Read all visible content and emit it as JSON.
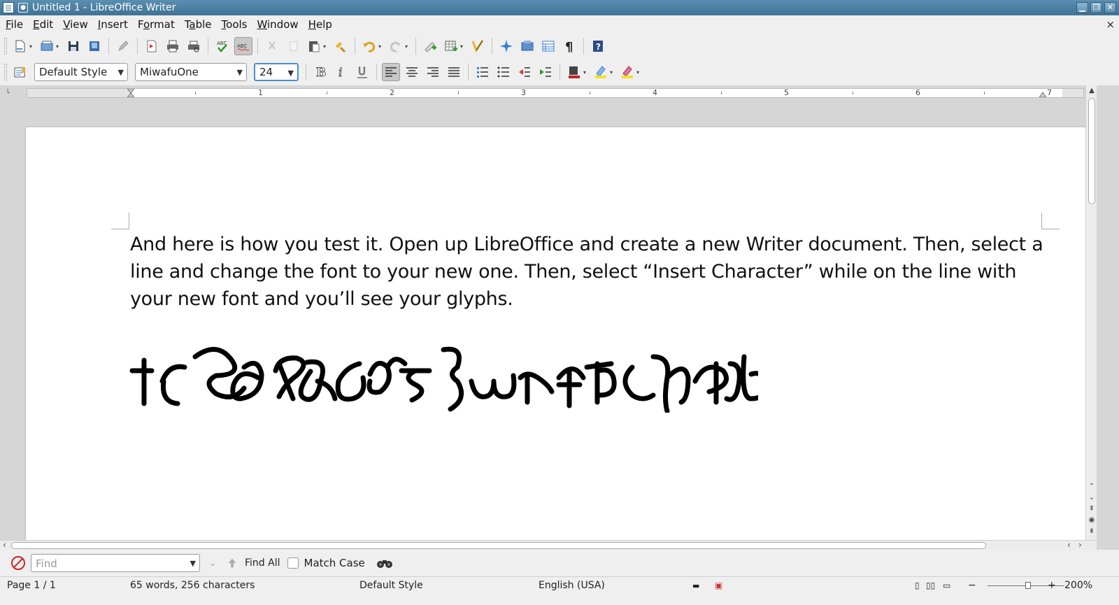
{
  "window": {
    "title": "Untitled 1 - LibreOffice Writer",
    "minimize": "▁",
    "restore": "❐",
    "close": "✕"
  },
  "menu": {
    "items": [
      {
        "pre": "",
        "u": "F",
        "post": "ile"
      },
      {
        "pre": "",
        "u": "E",
        "post": "dit"
      },
      {
        "pre": "",
        "u": "V",
        "post": "iew"
      },
      {
        "pre": "",
        "u": "I",
        "post": "nsert"
      },
      {
        "pre": "F",
        "u": "o",
        "post": "rmat"
      },
      {
        "pre": "T",
        "u": "a",
        "post": "ble"
      },
      {
        "pre": "",
        "u": "T",
        "post": "ools"
      },
      {
        "pre": "",
        "u": "W",
        "post": "indow"
      },
      {
        "pre": "",
        "u": "H",
        "post": "elp"
      }
    ],
    "doc_close": "×"
  },
  "formatting": {
    "paragraph_style": "Default Style",
    "font_name": "MiwafuOne",
    "font_size": "24"
  },
  "ruler": {
    "numbers": [
      "1",
      "2",
      "3",
      "4",
      "5",
      "6",
      "7"
    ]
  },
  "document": {
    "paragraph": "And here is how you test it. Open up LibreOffice and create a new Writer document. Then, select a line and change the font to your new one. Then, select “Insert Character” while on the line with your new font and you’ll see your glyphs."
  },
  "findbar": {
    "placeholder": "Find",
    "find_all": "Find All",
    "match_case": "Match Case"
  },
  "status": {
    "page": "Page 1 / 1",
    "words": "65 words, 256 characters",
    "style": "Default Style",
    "language": "English (USA)",
    "zoom": "200%"
  },
  "colors": {
    "titlebar": "#3f7396",
    "toolbar_bg": "#efefef",
    "workspace": "#d6d6d6",
    "accent": "#4a8fd0"
  }
}
